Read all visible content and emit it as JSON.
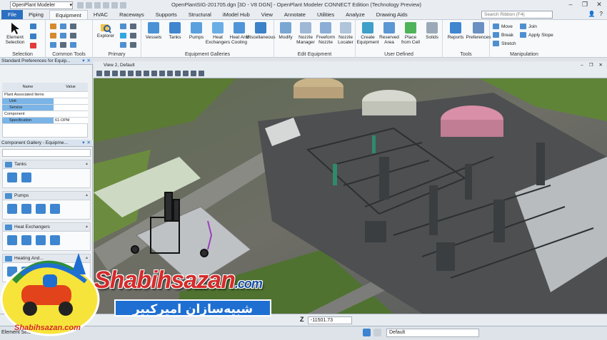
{
  "window": {
    "quick_access_value": "OpenPlant Modeler",
    "title": "OpenPlantSIG-201705.dgn [3D - V8 DGN] - OpenPlant Modeler CONNECT Edition (Technology Preview)",
    "minimize": "–",
    "restore": "❐",
    "close": "✕"
  },
  "ribbon_tabs": [
    "File",
    "Piping",
    "Equipment",
    "HVAC",
    "Raceways",
    "Supports",
    "Structural",
    "iModel Hub",
    "View",
    "Annotate",
    "Utilities",
    "Analyze",
    "Drawing Aids"
  ],
  "active_tab": "Equipment",
  "search_ribbon_placeholder": "Search Ribbon (F4)",
  "ribbon": {
    "selection": {
      "label": "Selection",
      "element_selection": "Element Selection"
    },
    "common_tools": {
      "label": "Common Tools"
    },
    "primary": {
      "label": "Primary",
      "explorer": "Explorer"
    },
    "galleries": {
      "label": "Equipment Galleries",
      "items": [
        "Vessels",
        "Tanks",
        "Pumps",
        "Heat Exchangers",
        "Heat And Cooling",
        "Miscellaneous"
      ]
    },
    "edit": {
      "label": "Edit Equipment",
      "items": [
        "Modify",
        "Nozzle Manager",
        "Freeform Nozzle",
        "Nozzle Locater"
      ]
    },
    "user_defined": {
      "label": "User Defined",
      "items": [
        "Create Equipment",
        "Reserved Area",
        "Place from Cell",
        "Solids"
      ]
    },
    "tools": {
      "label": "Tools",
      "items": [
        "Reports",
        "Preferences"
      ]
    },
    "manipulation": {
      "label": "Manipulation",
      "items": [
        "Move",
        "Join",
        "Break",
        "Apply Slope",
        "Stretch"
      ]
    }
  },
  "prefs_panel": {
    "title": "Standard Preferences for Equip...",
    "col_name": "Name",
    "col_value": "Value",
    "rows": [
      {
        "name": "Plant Associated Items",
        "value": ""
      },
      {
        "name": "Unit",
        "value": ""
      },
      {
        "name": "Service",
        "value": ""
      },
      {
        "name": "Component",
        "value": ""
      },
      {
        "name": "Specification",
        "value": "61-OPM"
      }
    ]
  },
  "gallery_panel": {
    "title": "Component Gallery - Equipme...",
    "categories": [
      "Tanks",
      "Pumps",
      "Heat Exchangers",
      "Heating And..."
    ]
  },
  "view": {
    "title": "View 2, Default"
  },
  "coords": {
    "z_label": "Z",
    "z_value": "-11501.73"
  },
  "status": {
    "prompt": "Element Selection",
    "level": "Default"
  },
  "watermark": {
    "brand": "Shabihsazan",
    "dotcom": ".com",
    "persian": "شبیه‌سازان امیرکبیر",
    "logo_text": "Shabihsazan.com"
  },
  "colors": {
    "file_tab": "#2a6fc0",
    "brand_red": "#d52b2b",
    "brand_blue": "#1e6fd1"
  }
}
